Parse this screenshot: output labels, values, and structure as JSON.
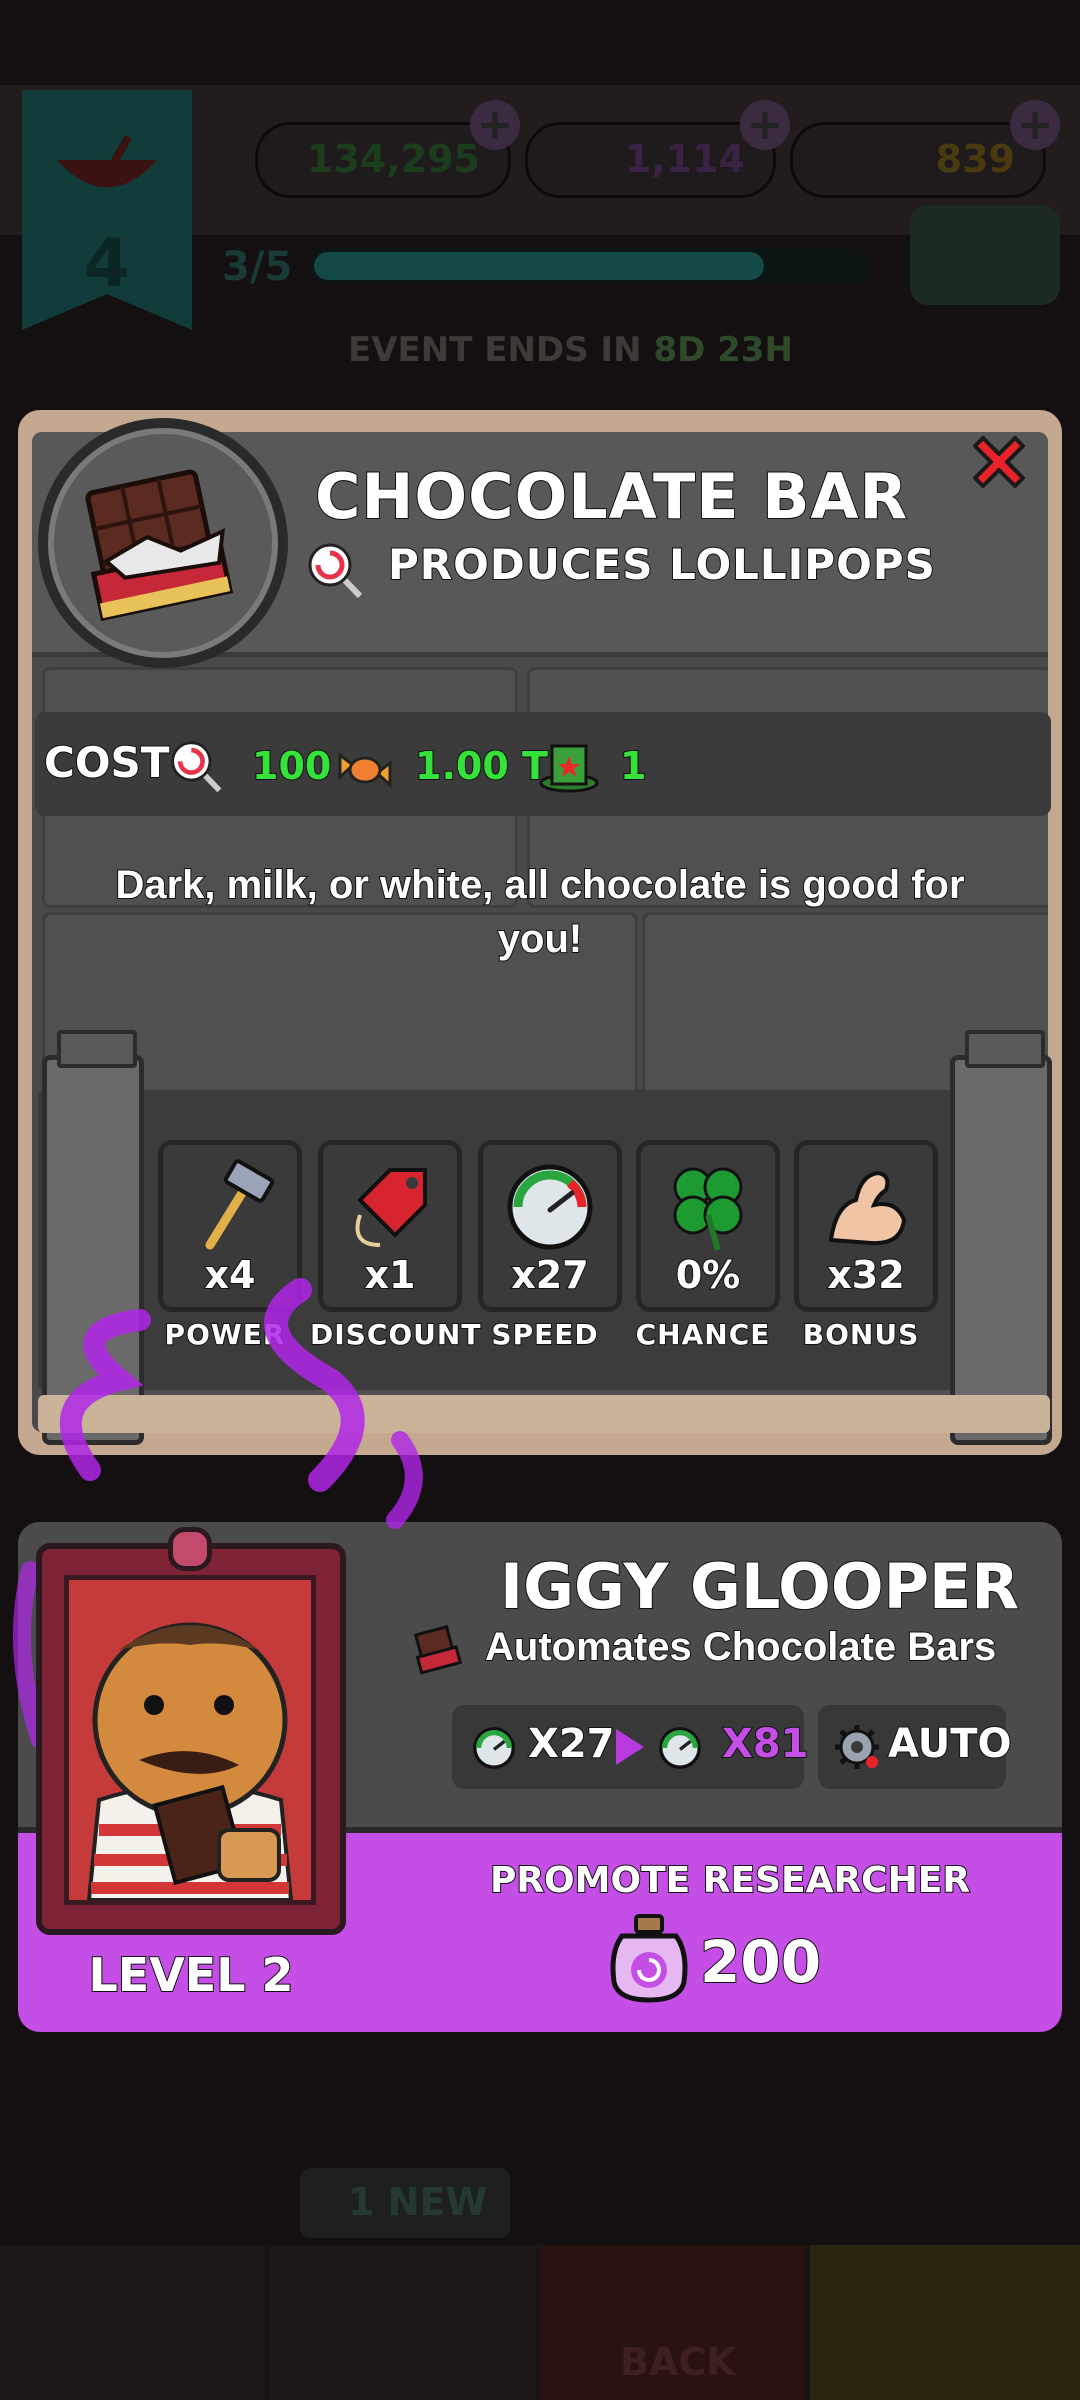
{
  "background": {
    "player_level": "4",
    "currency_hats": "134,295",
    "currency_potions": "1,114",
    "currency_gold": "839",
    "progress_text": "3/5",
    "event_label": "EVENT ENDS IN",
    "event_time": "8D 23H",
    "nav_new_badge": "1 NEW",
    "nav_back_label": "BACK"
  },
  "item": {
    "title": "CHOCOLATE BAR",
    "subtitle": "PRODUCES LOLLIPOPS",
    "cost_label": "COST",
    "costs": [
      "100",
      "1.00 T",
      "1"
    ],
    "description": "Dark, milk, or white, all chocolate is good for you!"
  },
  "stats": [
    {
      "value": "x4",
      "label": "POWER",
      "icon": "hammer-icon"
    },
    {
      "value": "x1",
      "label": "DISCOUNT",
      "icon": "price-tag-icon"
    },
    {
      "value": "x27",
      "label": "SPEED",
      "icon": "speedometer-icon"
    },
    {
      "value": "0%",
      "label": "CHANCE",
      "icon": "four-leaf-clover-icon"
    },
    {
      "value": "x32",
      "label": "BONUS",
      "icon": "flexed-arm-icon"
    }
  ],
  "researcher": {
    "name": "IGGY GLOOPER",
    "description": "Automates Chocolate Bars",
    "speed_from": "X27",
    "speed_to": "X81",
    "auto_label": "AUTO",
    "promote_label": "PROMOTE RESEARCHER",
    "promote_cost": "200",
    "level": "LEVEL 2"
  },
  "colors": {
    "accent_purple": "#c54ee6",
    "cost_green": "#35e23a",
    "speed_purple": "#c54ee6",
    "close_red": "#e8242a"
  }
}
